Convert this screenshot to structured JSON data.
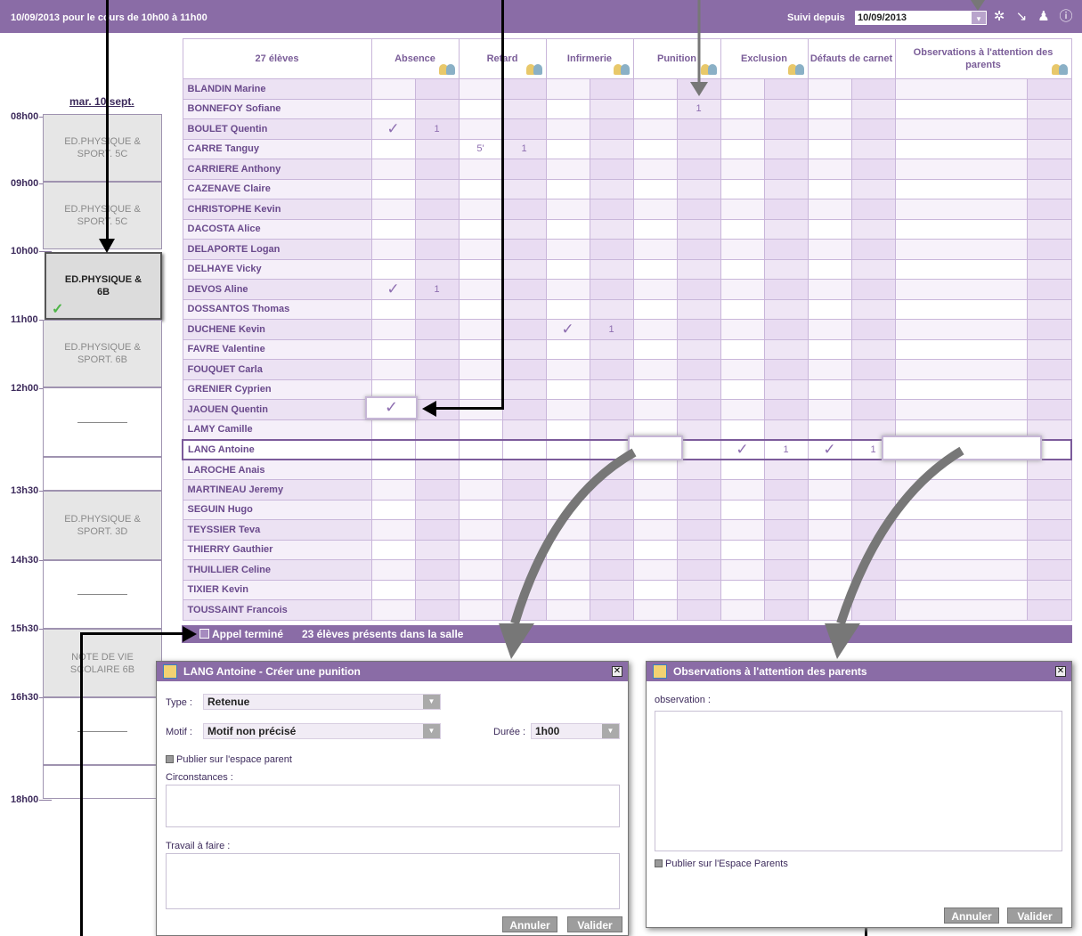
{
  "topbar": {
    "title": "10/09/2013 pour le cours de 10h00 à 11h00",
    "suivi_label": "Suivi depuis",
    "suivi_date": "10/09/2013",
    "dropdown_glyph": "▾",
    "icons": [
      {
        "name": "gear-icon",
        "glyph": "✲"
      },
      {
        "name": "arrow-return-icon",
        "glyph": "↘"
      },
      {
        "name": "person-icon",
        "glyph": "♟"
      },
      {
        "name": "info-icon",
        "glyph": "ⓘ"
      }
    ]
  },
  "timeline": {
    "day_label": "mar. 10 sept.",
    "hours": [
      "08h00",
      "09h00",
      "10h00",
      "11h00",
      "12h00",
      "13h30",
      "14h30",
      "15h30",
      "16h30",
      "18h00"
    ],
    "slots": [
      {
        "label": "ED.PHYSIQUE & SPORT. 5C",
        "kind": "course"
      },
      {
        "label": "ED.PHYSIQUE & SPORT. 5C",
        "kind": "course"
      },
      {
        "label": "ED.PHYSIQUE & 6B",
        "kind": "current",
        "check": "✓"
      },
      {
        "label": "ED.PHYSIQUE & SPORT. 6B",
        "kind": "course"
      },
      {
        "label": "",
        "kind": "empty"
      },
      {
        "label": "",
        "kind": "blank"
      },
      {
        "label": "ED.PHYSIQUE & SPORT. 3D",
        "kind": "course"
      },
      {
        "label": "",
        "kind": "empty"
      },
      {
        "label": "NOTE DE VIE SCOLAIRE 6B",
        "kind": "course"
      },
      {
        "label": "",
        "kind": "empty"
      },
      {
        "label": "",
        "kind": "blank"
      }
    ]
  },
  "grid": {
    "student_count_label": "27 élèves",
    "columns": [
      "Absence",
      "Retard",
      "Infirmerie",
      "Punition",
      "Exclusion",
      "Défauts de carnet",
      "Observations à l'attention des parents"
    ],
    "check_glyph": "✓",
    "rows": [
      {
        "name": "BLANDIN Marine",
        "cells": [
          "",
          "",
          "",
          "",
          "",
          "",
          "",
          "",
          "",
          "",
          "",
          "",
          "",
          ""
        ]
      },
      {
        "name": "BONNEFOY Sofiane",
        "cells": [
          "",
          "",
          "",
          "",
          "",
          "",
          "",
          "1",
          "",
          "",
          "",
          "",
          "",
          ""
        ]
      },
      {
        "name": "BOULET Quentin",
        "cells": [
          "✓",
          "1",
          "",
          "",
          "",
          "",
          "",
          "",
          "",
          "",
          "",
          "",
          "",
          ""
        ]
      },
      {
        "name": "CARRE Tanguy",
        "cells": [
          "",
          "",
          "5'",
          "1",
          "",
          "",
          "",
          "",
          "",
          "",
          "",
          "",
          "",
          ""
        ]
      },
      {
        "name": "CARRIERE Anthony",
        "cells": [
          "",
          "",
          "",
          "",
          "",
          "",
          "",
          "",
          "",
          "",
          "",
          "",
          "",
          ""
        ]
      },
      {
        "name": "CAZENAVE Claire",
        "cells": [
          "",
          "",
          "",
          "",
          "",
          "",
          "",
          "",
          "",
          "",
          "",
          "",
          "",
          ""
        ]
      },
      {
        "name": "CHRISTOPHE Kevin",
        "cells": [
          "",
          "",
          "",
          "",
          "",
          "",
          "",
          "",
          "",
          "",
          "",
          "",
          "",
          ""
        ]
      },
      {
        "name": "DACOSTA Alice",
        "cells": [
          "",
          "",
          "",
          "",
          "",
          "",
          "",
          "",
          "",
          "",
          "",
          "",
          "",
          ""
        ]
      },
      {
        "name": "DELAPORTE Logan",
        "cells": [
          "",
          "",
          "",
          "",
          "",
          "",
          "",
          "",
          "",
          "",
          "",
          "",
          "",
          ""
        ]
      },
      {
        "name": "DELHAYE Vicky",
        "cells": [
          "",
          "",
          "",
          "",
          "",
          "",
          "",
          "",
          "",
          "",
          "",
          "",
          "",
          ""
        ]
      },
      {
        "name": "DEVOS Aline",
        "cells": [
          "✓",
          "1",
          "",
          "",
          "",
          "",
          "",
          "",
          "",
          "",
          "",
          "",
          "",
          ""
        ]
      },
      {
        "name": "DOSSANTOS Thomas",
        "cells": [
          "",
          "",
          "",
          "",
          "",
          "",
          "",
          "",
          "",
          "",
          "",
          "",
          "",
          ""
        ]
      },
      {
        "name": "DUCHENE Kevin",
        "cells": [
          "",
          "",
          "",
          "",
          "✓",
          "1",
          "",
          "",
          "",
          "",
          "",
          "",
          "",
          ""
        ]
      },
      {
        "name": "FAVRE Valentine",
        "cells": [
          "",
          "",
          "",
          "",
          "",
          "",
          "",
          "",
          "",
          "",
          "",
          "",
          "",
          ""
        ]
      },
      {
        "name": "FOUQUET Carla",
        "cells": [
          "",
          "",
          "",
          "",
          "",
          "",
          "",
          "",
          "",
          "",
          "",
          "",
          "",
          ""
        ]
      },
      {
        "name": "GRENIER Cyprien",
        "cells": [
          "",
          "",
          "",
          "",
          "",
          "",
          "",
          "",
          "",
          "",
          "",
          "",
          "",
          ""
        ]
      },
      {
        "name": "JAOUEN Quentin",
        "cells": [
          "",
          "",
          "",
          "",
          "",
          "",
          "",
          "",
          "",
          "",
          "",
          "",
          "",
          ""
        ]
      },
      {
        "name": "LAMY Camille",
        "cells": [
          "",
          "",
          "",
          "",
          "",
          "",
          "",
          "",
          "",
          "",
          "",
          "",
          "",
          ""
        ]
      },
      {
        "name": "LANG Antoine",
        "cells": [
          "",
          "",
          "",
          "",
          "",
          "",
          "",
          "",
          "✓",
          "1",
          "✓",
          "1",
          "",
          ""
        ]
      },
      {
        "name": "LAROCHE Anais",
        "cells": [
          "",
          "",
          "",
          "",
          "",
          "",
          "",
          "",
          "",
          "",
          "",
          "",
          "",
          ""
        ]
      },
      {
        "name": "MARTINEAU Jeremy",
        "cells": [
          "",
          "",
          "",
          "",
          "",
          "",
          "",
          "",
          "",
          "",
          "",
          "",
          "",
          ""
        ]
      },
      {
        "name": "SEGUIN Hugo",
        "cells": [
          "",
          "",
          "",
          "",
          "",
          "",
          "",
          "",
          "",
          "",
          "",
          "",
          "",
          ""
        ]
      },
      {
        "name": "TEYSSIER Teva",
        "cells": [
          "",
          "",
          "",
          "",
          "",
          "",
          "",
          "",
          "",
          "",
          "",
          "",
          "",
          ""
        ]
      },
      {
        "name": "THIERRY Gauthier",
        "cells": [
          "",
          "",
          "",
          "",
          "",
          "",
          "",
          "",
          "",
          "",
          "",
          "",
          "",
          ""
        ]
      },
      {
        "name": "THUILLIER Celine",
        "cells": [
          "",
          "",
          "",
          "",
          "",
          "",
          "",
          "",
          "",
          "",
          "",
          "",
          "",
          ""
        ]
      },
      {
        "name": "TIXIER Kevin",
        "cells": [
          "",
          "",
          "",
          "",
          "",
          "",
          "",
          "",
          "",
          "",
          "",
          "",
          "",
          ""
        ]
      },
      {
        "name": "TOUSSAINT Francois",
        "cells": [
          "",
          "",
          "",
          "",
          "",
          "",
          "",
          "",
          "",
          "",
          "",
          "",
          "",
          ""
        ]
      }
    ],
    "jaouen_check": "✓"
  },
  "footer": {
    "appel_label": "Appel terminé",
    "present_text": "23 élèves présents dans la salle"
  },
  "punition_dialog": {
    "title": "LANG Antoine - Créer une punition",
    "close": "✕",
    "type_label": "Type :",
    "type_value": "Retenue",
    "motif_label": "Motif :",
    "motif_value": "Motif non précisé",
    "duree_label": "Durée :",
    "duree_value": "1h00",
    "publish_label": "Publier sur l'espace parent",
    "circonstances_label": "Circonstances :",
    "travail_label": "Travail à faire :",
    "cancel": "Annuler",
    "validate": "Valider"
  },
  "observation_dialog": {
    "title": "Observations à l'attention des parents",
    "close": "✕",
    "observation_label": "observation :",
    "publish_label": "Publier sur l'Espace Parents",
    "cancel": "Annuler",
    "validate": "Valider"
  },
  "colors": {
    "header_purple": "#8a6ca6",
    "name_text": "#6a4a8c",
    "check_purple": "#8e6eb0",
    "present_green": "#4fb548"
  }
}
